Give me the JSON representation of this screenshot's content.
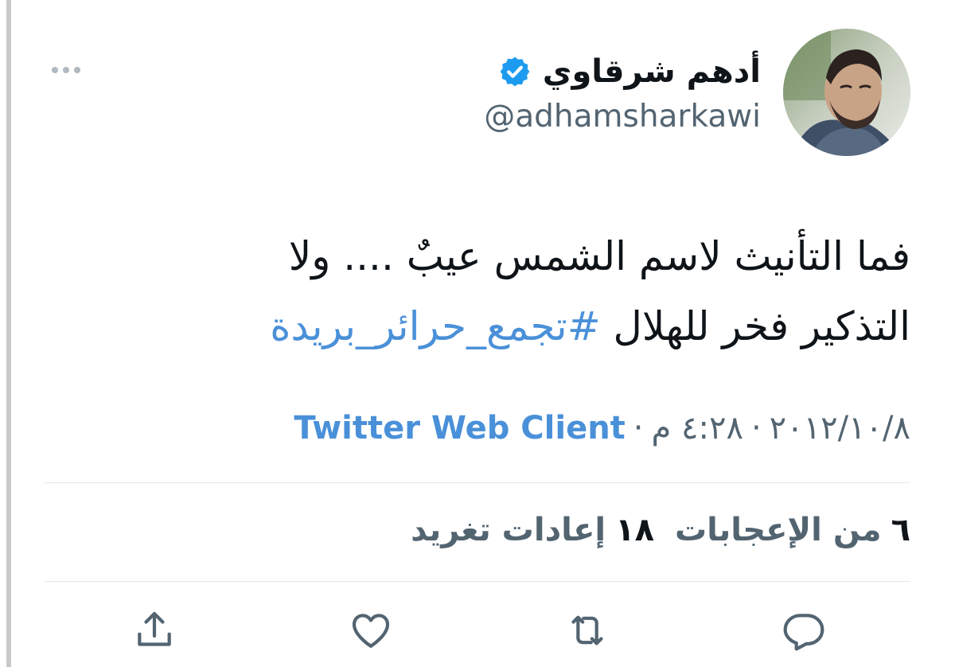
{
  "author": {
    "display_name": "أدهم شرقاوي",
    "handle": "@adhamsharkawi",
    "verified": true,
    "avatar_icon": "user-photo"
  },
  "tweet": {
    "text_line1": "فما التأنيث لاسم الشمس عيبٌ .... ولا",
    "text_line2_plain": "التذكير فخر للهلال",
    "hashtag": "#تجمع_حرائر_بريدة"
  },
  "meta": {
    "date": "٢٠١٢/١٠/٨",
    "separator": "·",
    "time": "٤:٢٨ م",
    "source": "Twitter Web Client"
  },
  "stats": {
    "retweets_count": "١٨",
    "retweets_label": "إعادات تغريد",
    "likes_count": "٦",
    "likes_label": "من الإعجابات"
  },
  "actions": {
    "reply_icon": "reply-icon",
    "retweet_icon": "retweet-icon",
    "like_icon": "heart-icon",
    "share_icon": "share-icon"
  },
  "colors": {
    "link": "#4a90d9",
    "secondary_text": "#536471",
    "primary_text": "#0f1419",
    "divider": "#e1e8ed",
    "verified": "#1d9bf0"
  }
}
